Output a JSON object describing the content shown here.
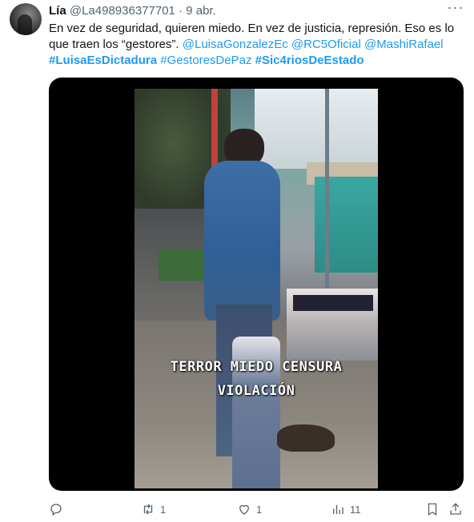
{
  "tweet": {
    "author_name": "Lía",
    "author_handle": "@La498936377701",
    "separator": "·",
    "date": "9 abr.",
    "more_label": "···",
    "text_plain": "En vez de seguridad, quieren miedo. En vez de justicia, represión. Eso es lo que traen los “gestores”.",
    "mentions": [
      "@LuisaGonzalezEc",
      "@RC5Oficial",
      "@MashiRafael"
    ],
    "hashtags": [
      {
        "text": "#LuisaEsDictadura",
        "bold": true
      },
      {
        "text": "#GestoresDePaz",
        "bold": false
      },
      {
        "text": "#Sic4riosDeEstado",
        "bold": true
      }
    ]
  },
  "media": {
    "caption_line1": "TERROR MIEDO CENSURA",
    "caption_line2": "VIOLACIÓN"
  },
  "actions": {
    "reply_count": "",
    "retweet_count": "1",
    "like_count": "1",
    "views_count": "11"
  },
  "colors": {
    "accent": "#1d9bf0",
    "secondary_text": "#536471",
    "primary_text": "#0f1419"
  }
}
